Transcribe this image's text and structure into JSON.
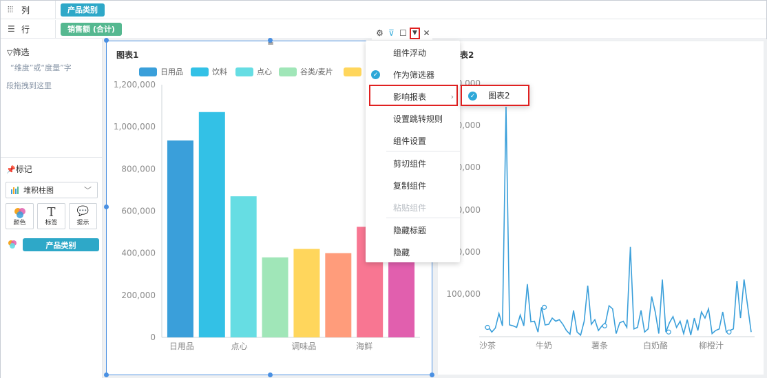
{
  "shelves": {
    "columns": {
      "label": "列",
      "pill": "产品类别"
    },
    "rows": {
      "label": "行",
      "pill": "销售额 (合计)"
    }
  },
  "left_panel": {
    "filter_title": "筛选",
    "filter_hint_line1": "“维度”或“度量”字",
    "filter_hint_line2": "段拖拽到这里",
    "marks_title": "标记",
    "chart_type": "堆积柱图",
    "mark_buttons": [
      {
        "label": "颜色",
        "icon": "palette-icon"
      },
      {
        "label": "标签",
        "icon": "text-icon"
      },
      {
        "label": "提示",
        "icon": "tooltip-icon"
      }
    ],
    "color_field": "产品类别"
  },
  "chart1": {
    "title": "图表1",
    "legend": [
      "日用品",
      "饮料",
      "点心",
      "谷类/麦片",
      ""
    ],
    "y_ticks": [
      "1,200,000",
      "1,000,000",
      "800,000",
      "600,000",
      "400,000",
      "200,000",
      "0"
    ],
    "x_labels": [
      "日用品",
      "点心",
      "调味品",
      "海鲜"
    ]
  },
  "chart2": {
    "title": "表2",
    "y_ticks": [
      "100,000",
      "00,000",
      "00,000",
      "00,000",
      "00,000",
      "00,000"
    ],
    "x_labels": [
      "沙茶",
      "牛奶",
      "薯条",
      "白奶酪",
      "柳橙汁"
    ]
  },
  "context_menu": {
    "items": [
      {
        "label": "组件浮动",
        "checked": false,
        "disabled": false
      },
      {
        "label": "作为筛选器",
        "checked": true,
        "disabled": false
      },
      {
        "label": "影响报表",
        "checked": false,
        "disabled": false,
        "submenu": true
      },
      {
        "label": "设置跳转规则",
        "checked": false,
        "disabled": false
      },
      {
        "label": "组件设置",
        "checked": false,
        "disabled": false
      },
      {
        "label": "剪切组件",
        "checked": false,
        "disabled": false
      },
      {
        "label": "复制组件",
        "checked": false,
        "disabled": false
      },
      {
        "label": "粘贴组件",
        "checked": false,
        "disabled": true
      },
      {
        "label": "隐藏标题",
        "checked": false,
        "disabled": false
      },
      {
        "label": "隐藏",
        "checked": false,
        "disabled": false
      }
    ],
    "submenu_item": "图表2"
  },
  "chart_data": [
    {
      "type": "bar",
      "title": "图表1",
      "categories": [
        "日用品",
        "饮料",
        "点心",
        "谷类/麦片",
        "调味品",
        "",
        "海鲜",
        ""
      ],
      "values": [
        935000,
        1070000,
        670000,
        380000,
        420000,
        400000,
        525000,
        500000
      ],
      "colors": [
        "#3a9fda",
        "#33c1e6",
        "#66dde3",
        "#a0e6b8",
        "#ffd65c",
        "#ff9c7b",
        "#f87692",
        "#e15fae"
      ],
      "ylim": [
        0,
        1200000
      ]
    },
    {
      "type": "line",
      "title": "表2",
      "x_labels": [
        "沙茶",
        "牛奶",
        "薯条",
        "白奶酪",
        "柳橙汁"
      ],
      "values": [
        30,
        32,
        15,
        28,
        75,
        35,
        780,
        38,
        35,
        30,
        70,
        35,
        170,
        48,
        50,
        15,
        95,
        38,
        40,
        60,
        50,
        55,
        40,
        20,
        8,
        85,
        15,
        5,
        50,
        165,
        40,
        55,
        20,
        35,
        45,
        100,
        90,
        10,
        45,
        50,
        30,
        290,
        25,
        30,
        85,
        15,
        25,
        130,
        80,
        10,
        185,
        15,
        45,
        65,
        30,
        50,
        10,
        55,
        5,
        60,
        20,
        80,
        60,
        90,
        10,
        20,
        25,
        80,
        15,
        20,
        25,
        180,
        60,
        185,
        100,
        15
      ],
      "ylim": [
        0,
        750
      ]
    }
  ],
  "colors": {
    "accent": "#2ea8c8",
    "selection": "#4a90e2",
    "highlight": "#e02020",
    "line": "#3a9fda"
  }
}
